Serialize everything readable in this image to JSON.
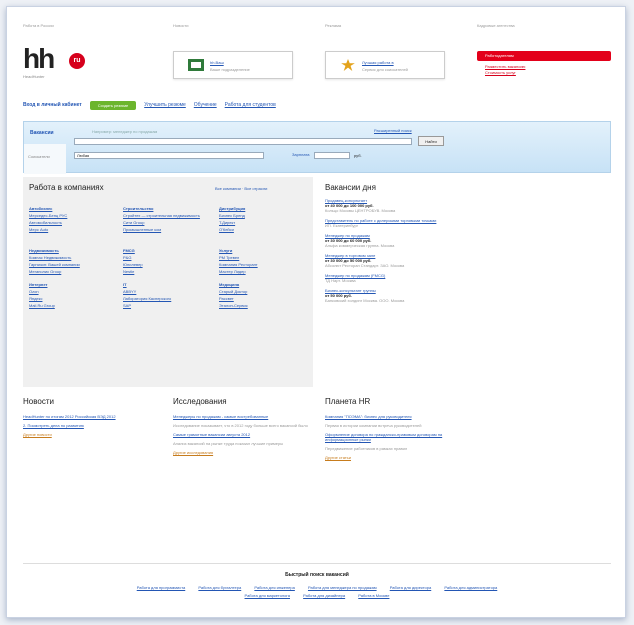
{
  "header": {
    "top_labels": [
      "Работа в России",
      "Новости",
      "Реклама",
      "Кадровые агентства"
    ],
    "logo_text": "hh",
    "logo_badge": "ru",
    "logo_sub": "HeadHunter",
    "promo1": {
      "title": "hh.Ваш",
      "sub": "Ваше подразделение"
    },
    "promo2": {
      "title": "Лучшая работа в",
      "sub": "Сервис для соискателей"
    },
    "red_button": "Работодателям",
    "red_links": [
      "Разместить вакансию",
      "Стоимость услуг"
    ]
  },
  "nav": {
    "login": "Вход в личный кабинет",
    "create": "Создать резюме",
    "items": [
      "Улучшить резюме",
      "Обучение",
      "Работа для студентов"
    ]
  },
  "search": {
    "tab_vacancies": "Вакансии",
    "tab_resumes": "Соискатели",
    "hint": "Например: менеджер по продажам",
    "button": "Найти",
    "region": "Любая",
    "salary_label": "Зарплата",
    "currency": "руб.",
    "advanced": "Расширенный поиск"
  },
  "companies": {
    "title": "Работа в компаниях",
    "links": "Все компании · Все отрасли",
    "columns": [
      {
        "groups": [
          [
            "Автобизнес",
            "Мерседес-Бенц РУС",
            "Автомобильность",
            "Мерс Auto"
          ],
          [
            "Недвижимость",
            "Компас Недвижимость",
            "Гарнизон: Вашей компании",
            "Мегаполис Group"
          ],
          [
            "Интернет",
            "Ozon",
            "Яндекс",
            "Mail.Ru Group"
          ]
        ]
      },
      {
        "groups": [
          [
            "Строительство",
            "Стройтех — строительная недвижимость",
            "Сити Group",
            "Промышленные ком"
          ],
          [
            "FMCG",
            "P&G",
            "Юнилевер",
            "Nestle"
          ],
          [
            "IT",
            "ABBYY",
            "Лаборатория Касперского",
            "SAP"
          ]
        ]
      },
      {
        "groups": [
          [
            "Дистрибуция",
            "Бизнес Бренд",
            "Т.Директ",
            "О'Кейси"
          ],
          [
            "Услуги",
            "РМ Тревел",
            "Компания Ресторант",
            "Мастер Лидер"
          ],
          [
            "Медицина",
            "Старый Доктор",
            "Рассвет",
            "Эталон-Сервис"
          ]
        ]
      }
    ]
  },
  "vacancies": {
    "title": "Вакансии дня",
    "items": [
      {
        "t": "Продавец-консультант",
        "s": "от 40 000 до 100 000 руб.",
        "c": "Кольцо Москвы ЦЕНТРОБУВ. Москва"
      },
      {
        "t": "Представитель по работе с дилерскими торговыми точками",
        "s": "",
        "c": "ИП. Екатеринбург"
      },
      {
        "t": "Менеджер по продажам",
        "s": "от 30 000 до 60 000 руб.",
        "c": "Альфа коммерческая группа. Москва"
      },
      {
        "t": "Менеджер в торговом зале",
        "s": "от 30 000 до 50 000 руб.",
        "c": "Абсолют Ресторан Стандарт. ЗАО. Москва"
      },
      {
        "t": "Менеджер по продажам (FMCG)",
        "s": "",
        "c": "ТД Нарт. Москва"
      },
      {
        "t": "Бизнес-консультант группы",
        "s": "от 50 000 руб.",
        "c": "Банковский холдинг Москва. ООО. Москва"
      }
    ]
  },
  "news": {
    "title": "Новости",
    "items": [
      "HeadHunter по итогам 2012 Российская ВЭД 2012",
      "2. Посмотреть дела по развитию"
    ],
    "more": "Другие новости"
  },
  "research": {
    "title": "Исследования",
    "items": [
      {
        "l": "Менеджеры по продажам - самые востребованные",
        "g": "Исследование показывает, что в 2012 году больше всего вакансий было"
      },
      {
        "l": "Самые грамотные вакансии августа 2012",
        "g": "Анализ вакансий на рынке труда показал лучшие примеры"
      }
    ],
    "more": "Другие исследования"
  },
  "planet": {
    "title": "Планета HR",
    "items": [
      {
        "l": "Компания \"ПОЭМА\": бизнес для руководителя",
        "g": "Первая в истории компании встреча руководителей"
      },
      {
        "l": "Оформление договора по гражданско-правовым договорам на информационные рынки",
        "g": "Передвижение работников в рамках правил"
      }
    ],
    "more": "Другие статьи"
  },
  "footer": {
    "title": "Быстрый поиск вакансий",
    "links": [
      "Работа для программиста",
      "Работа для бухгалтера",
      "Работа для инженера",
      "Работа для менеджера по продажам",
      "Работа для директора",
      "Работа для администратора",
      "Работа для маркетолога",
      "Работа для дизайнера",
      "Работа в Москве"
    ]
  }
}
